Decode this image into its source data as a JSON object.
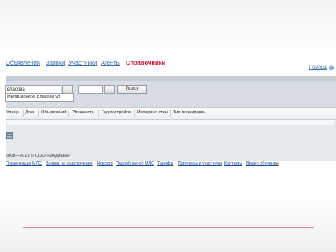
{
  "nav": {
    "items": [
      "Объявления",
      "Заявки",
      "Участники",
      "Агенты",
      "Справочники"
    ],
    "active_index": 4,
    "help_label": "Помощь",
    "help_icon_text": "?"
  },
  "search": {
    "street_value": "власова",
    "suggestion": "Милиционера Власова ул",
    "house_value": "",
    "search_button": "Поиск"
  },
  "columns": [
    "Улица",
    "Дом",
    "Объявлений",
    "Этажность",
    "Год постройки",
    "Материал стен",
    "Тип планировки"
  ],
  "footer": {
    "copyright": "2008—2013 © ООО «Медиана»",
    "links": [
      "Презентация МЛС",
      "Заявка на подключение",
      "Новости",
      "Подробнее об МЛС",
      "Тарифы",
      "Партнеры и участники",
      "Контакты",
      "Видео обучение"
    ]
  },
  "colors": {
    "link": "#3a6ea8",
    "active": "#c8102e",
    "panel": "#d7dde2",
    "rule": "#d28b80"
  }
}
